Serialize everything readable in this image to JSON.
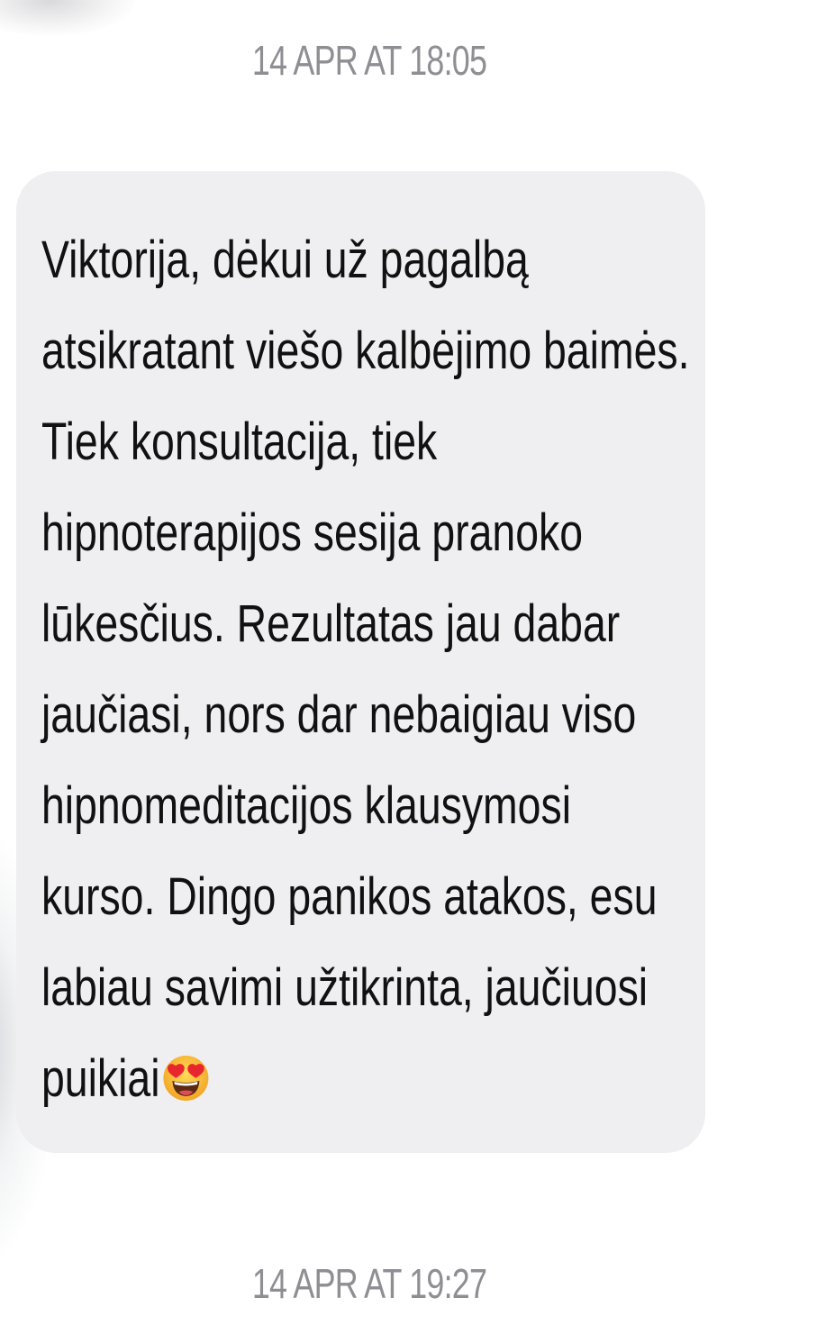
{
  "conversation": {
    "timestamp_top": "14 APR AT 18:05",
    "timestamp_bottom": "14 APR AT 19:27",
    "message": {
      "lines": [
        "Viktorija, dėkui už pagalbą",
        "atsikratant viešo kalbėjimo baimės.",
        "Tiek konsultacija, tiek",
        "hipnoterapijos sesija pranoko",
        "lūkesčius. Rezultatas jau dabar",
        "jaučiasi, nors dar nebaigiau viso",
        "hipnomeditacijos klausymosi",
        "kurso. Dingo panikos atakos, esu",
        "labiau savimi užtikrinta, jaučiuosi",
        "puikiai"
      ],
      "emoji": "heart-eyes-emoji"
    }
  },
  "colors": {
    "bubble": "#efeff1",
    "timestamp": "#8e8e93",
    "text": "#111111"
  }
}
